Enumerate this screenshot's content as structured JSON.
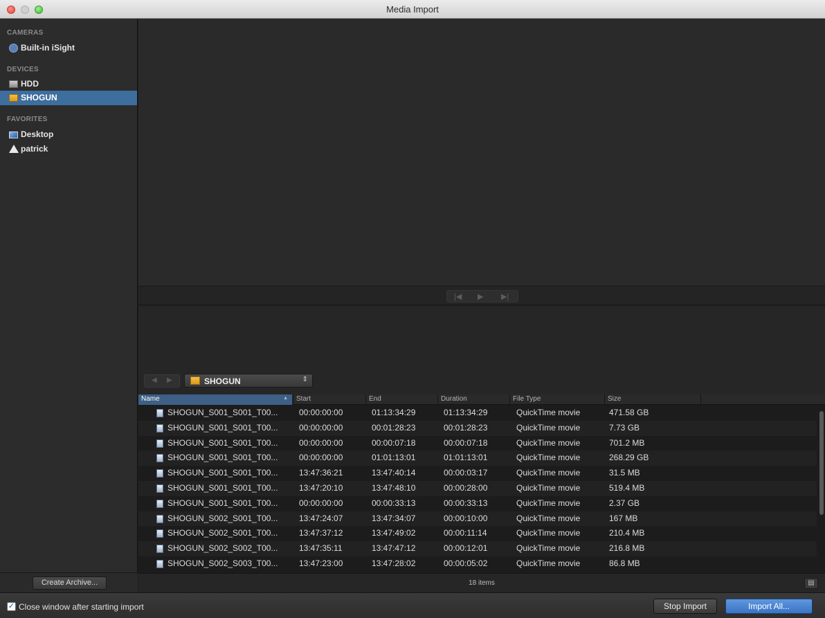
{
  "window": {
    "title": "Media Import"
  },
  "sidebar": {
    "sections": [
      {
        "heading": "CAMERAS",
        "items": [
          {
            "label": "Built-in iSight",
            "icon": "camera-icon"
          }
        ]
      },
      {
        "heading": "DEVICES",
        "items": [
          {
            "label": "HDD",
            "icon": "hard-drive-icon"
          },
          {
            "label": "SHOGUN",
            "icon": "external-drive-icon",
            "selected": true
          }
        ]
      },
      {
        "heading": "FAVORITES",
        "items": [
          {
            "label": "Desktop",
            "icon": "desktop-icon"
          },
          {
            "label": "patrick",
            "icon": "home-icon"
          }
        ]
      }
    ],
    "create_archive_label": "Create Archive..."
  },
  "browser": {
    "location": "SHOGUN",
    "columns": [
      "Name",
      "Start",
      "End",
      "Duration",
      "File Type",
      "Size"
    ],
    "rows": [
      [
        "SHOGUN_S001_S001_T00...",
        "00:00:00:00",
        "01:13:34:29",
        "01:13:34:29",
        "QuickTime movie",
        "471.58 GB"
      ],
      [
        "SHOGUN_S001_S001_T00...",
        "00:00:00:00",
        "00:01:28:23",
        "00:01:28:23",
        "QuickTime movie",
        "7.73 GB"
      ],
      [
        "SHOGUN_S001_S001_T00...",
        "00:00:00:00",
        "00:00:07:18",
        "00:00:07:18",
        "QuickTime movie",
        "701.2 MB"
      ],
      [
        "SHOGUN_S001_S001_T00...",
        "00:00:00:00",
        "01:01:13:01",
        "01:01:13:01",
        "QuickTime movie",
        "268.29 GB"
      ],
      [
        "SHOGUN_S001_S001_T00...",
        "13:47:36:21",
        "13:47:40:14",
        "00:00:03:17",
        "QuickTime movie",
        "31.5 MB"
      ],
      [
        "SHOGUN_S001_S001_T00...",
        "13:47:20:10",
        "13:47:48:10",
        "00:00:28:00",
        "QuickTime movie",
        "519.4 MB"
      ],
      [
        "SHOGUN_S001_S001_T00...",
        "00:00:00:00",
        "00:00:33:13",
        "00:00:33:13",
        "QuickTime movie",
        "2.37 GB"
      ],
      [
        "SHOGUN_S002_S001_T00...",
        "13:47:24:07",
        "13:47:34:07",
        "00:00:10:00",
        "QuickTime movie",
        "167 MB"
      ],
      [
        "SHOGUN_S002_S001_T00...",
        "13:47:37:12",
        "13:47:49:02",
        "00:00:11:14",
        "QuickTime movie",
        "210.4 MB"
      ],
      [
        "SHOGUN_S002_S002_T00...",
        "13:47:35:11",
        "13:47:47:12",
        "00:00:12:01",
        "QuickTime movie",
        "216.8 MB"
      ],
      [
        "SHOGUN_S002_S003_T00...",
        "13:47:23:00",
        "13:47:28:02",
        "00:00:05:02",
        "QuickTime movie",
        "86.8 MB"
      ]
    ],
    "item_count": "18 items"
  },
  "footer": {
    "close_window_label": "Close window after starting import",
    "close_window_checked": true,
    "stop_import_label": "Stop Import",
    "import_all_label": "Import All..."
  },
  "colors": {
    "selection": "#3d6e9e",
    "primary_button": "#4a86d4"
  }
}
